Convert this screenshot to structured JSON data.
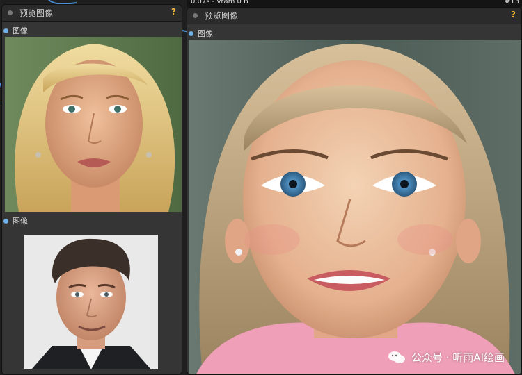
{
  "topbar": {
    "left_text": "0.07s - vram 0 B",
    "right_text": "#13"
  },
  "left_node": {
    "title": "预览图像",
    "help": "?",
    "slot1_label": "图像",
    "slot2_label": "图像"
  },
  "right_node": {
    "title": "预览图像",
    "help": "?",
    "slot_label": "图像"
  },
  "watermark": {
    "text": "公众号 · 听雨AI绘画"
  },
  "colors": {
    "slot_blue": "#6fb0e6",
    "help_orange": "#f2b630",
    "node_bg": "#353535"
  }
}
